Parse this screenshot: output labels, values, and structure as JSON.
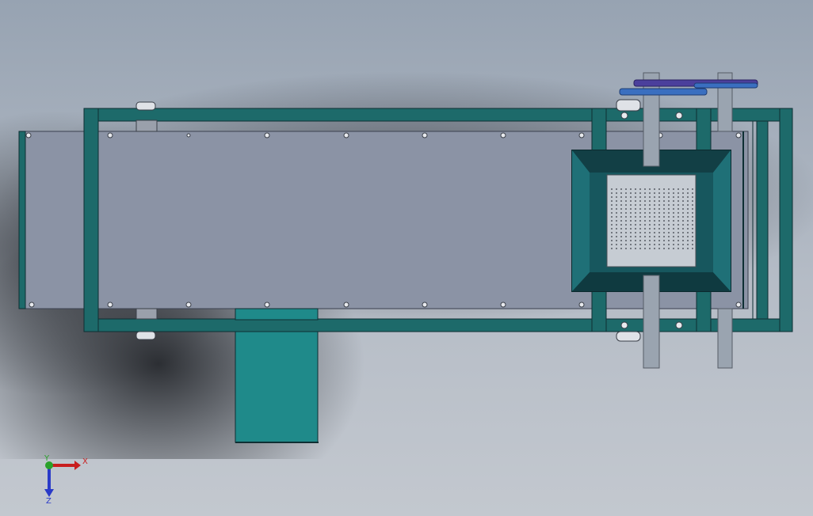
{
  "viewport": {
    "background_top": "#97a3b2",
    "background_bottom": "#c3c8cf"
  },
  "model": {
    "frame_color": "#1d6a6a",
    "frame_edge": "#0e2f33",
    "plate_color": "#8b93a5",
    "chute_color": "#1f8a8a",
    "hopper_color": "#1a5f66",
    "drum_color": "#c6ccd3",
    "shaft_color": "#9aa4b0",
    "pulley_color": "#3a6fc0",
    "pulley_dark": "#4b3f9c"
  },
  "triad": {
    "x_label": "X",
    "y_label": "Y",
    "z_label": "Z",
    "x_color": "#c81e1e",
    "y_color": "#2aa12a",
    "z_color": "#2a3ac8"
  }
}
